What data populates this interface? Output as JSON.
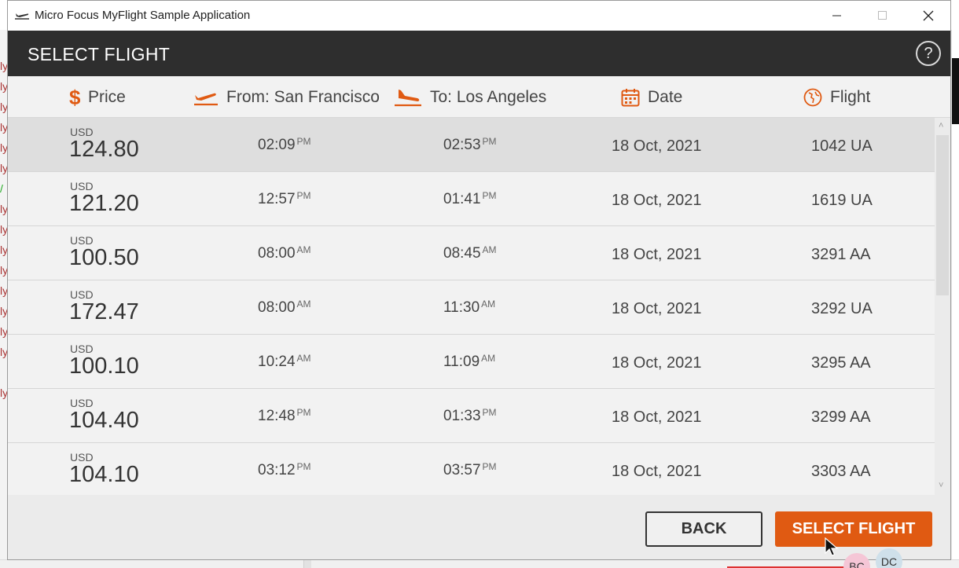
{
  "window": {
    "title": "Micro Focus MyFlight Sample Application"
  },
  "header": {
    "title": "SELECT FLIGHT",
    "help": "?"
  },
  "columns": {
    "price": "Price",
    "from": "From: San Francisco",
    "to": "To: Los Angeles",
    "date": "Date",
    "flight": "Flight"
  },
  "flights": [
    {
      "currency": "USD",
      "price": "124.80",
      "dep": "02:09",
      "dep_ampm": "PM",
      "arr": "02:53",
      "arr_ampm": "PM",
      "date": "18 Oct, 2021",
      "flight": "1042 UA"
    },
    {
      "currency": "USD",
      "price": "121.20",
      "dep": "12:57",
      "dep_ampm": "PM",
      "arr": "01:41",
      "arr_ampm": "PM",
      "date": "18 Oct, 2021",
      "flight": "1619 UA"
    },
    {
      "currency": "USD",
      "price": "100.50",
      "dep": "08:00",
      "dep_ampm": "AM",
      "arr": "08:45",
      "arr_ampm": "AM",
      "date": "18 Oct, 2021",
      "flight": "3291 AA"
    },
    {
      "currency": "USD",
      "price": "172.47",
      "dep": "08:00",
      "dep_ampm": "AM",
      "arr": "11:30",
      "arr_ampm": "AM",
      "date": "18 Oct, 2021",
      "flight": "3292 UA"
    },
    {
      "currency": "USD",
      "price": "100.10",
      "dep": "10:24",
      "dep_ampm": "AM",
      "arr": "11:09",
      "arr_ampm": "AM",
      "date": "18 Oct, 2021",
      "flight": "3295 AA"
    },
    {
      "currency": "USD",
      "price": "104.40",
      "dep": "12:48",
      "dep_ampm": "PM",
      "arr": "01:33",
      "arr_ampm": "PM",
      "date": "18 Oct, 2021",
      "flight": "3299 AA"
    },
    {
      "currency": "USD",
      "price": "104.10",
      "dep": "03:12",
      "dep_ampm": "PM",
      "arr": "03:57",
      "arr_ampm": "PM",
      "date": "18 Oct, 2021",
      "flight": "3303 AA"
    }
  ],
  "buttons": {
    "back": "BACK",
    "select": "SELECT FLIGHT"
  },
  "avatars": {
    "first": "BC",
    "second": "DC"
  },
  "colors": {
    "accent": "#e05a12",
    "header_bg": "#2e2e2e",
    "selected_row": "#dedede"
  }
}
